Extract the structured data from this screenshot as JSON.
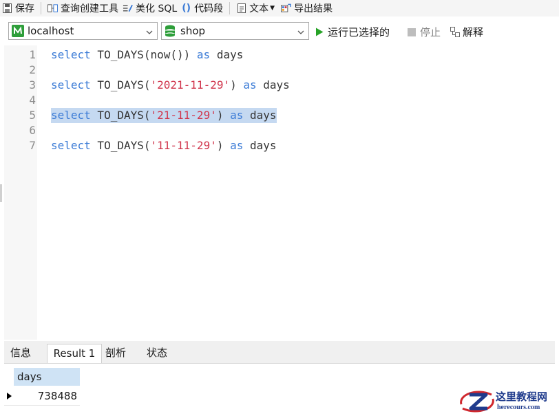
{
  "toolbar": {
    "save_label": "保存",
    "query_builder_label": "查询创建工具",
    "beautify_sql_label": "美化 SQL",
    "snippet_label": "代码段",
    "text_label": "文本",
    "export_label": "导出结果"
  },
  "connection": {
    "server": "localhost",
    "database": "shop"
  },
  "actions": {
    "run_selected_label": "运行已选择的",
    "stop_label": "停止",
    "explain_label": "解释"
  },
  "editor": {
    "lines": [
      {
        "num": "1",
        "kw1": "select",
        "fn": " TO_DAYS(now()) ",
        "kw2": "as",
        "alias": " days",
        "selected": false
      },
      {
        "num": "2"
      },
      {
        "num": "3",
        "kw1": "select",
        "fn": " TO_DAYS(",
        "str": "'2021-11-29'",
        "close": ") ",
        "kw2": "as",
        "alias": " days",
        "selected": false
      },
      {
        "num": "4"
      },
      {
        "num": "5",
        "kw1": "select",
        "fn": " TO_DAYS(",
        "str": "'21-11-29'",
        "close": ") ",
        "kw2": "as",
        "alias": " days",
        "selected": true
      },
      {
        "num": "6"
      },
      {
        "num": "7",
        "kw1": "select",
        "fn": " TO_DAYS(",
        "str": "'11-11-29'",
        "close": ") ",
        "kw2": "as",
        "alias": " days",
        "selected": false
      }
    ]
  },
  "tabs": [
    {
      "label": "信息",
      "active": false
    },
    {
      "label": "Result 1",
      "active": true
    },
    {
      "label": "剖析",
      "active": false
    },
    {
      "label": "状态",
      "active": false
    }
  ],
  "result": {
    "column": "days",
    "value": "738488"
  },
  "watermark": {
    "title": "这里教程网",
    "url": "herecours.com"
  },
  "colors": {
    "keyword": "#3b7bd6",
    "string": "#d0344b",
    "selection": "#c5d9f1",
    "run_green": "#27a327",
    "db_green": "#2e9e3a"
  },
  "icons": [
    "save-icon",
    "query-builder-icon",
    "beautify-icon",
    "snippet-icon",
    "text-icon",
    "export-icon",
    "server-icon",
    "database-icon",
    "run-icon",
    "stop-icon",
    "explain-icon"
  ]
}
